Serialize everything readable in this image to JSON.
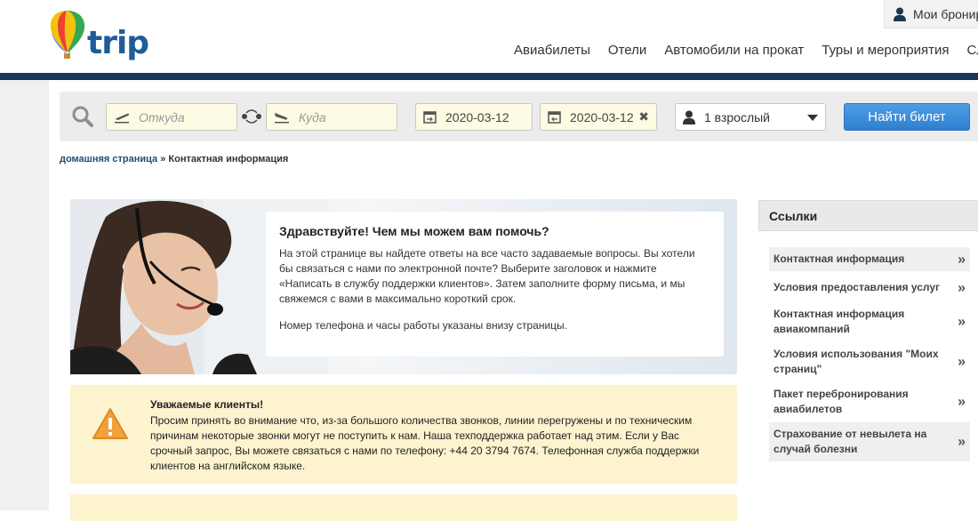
{
  "header": {
    "logo_text": "trip",
    "my_bookings": "Мои бронир",
    "nav": [
      "Авиабилеты",
      "Отели",
      "Автомобили на прокат",
      "Туры и мероприятия",
      "Сл"
    ]
  },
  "search": {
    "from_placeholder": "Откуда",
    "to_placeholder": "Куда",
    "date_depart": "2020-03-12",
    "date_return": "2020-03-12",
    "clear_symbol": "✖",
    "passengers": "1 взрослый",
    "submit": "Найти билет"
  },
  "breadcrumb": {
    "home": "домашняя страница",
    "separator": "»",
    "current": "Контактная информация"
  },
  "hero": {
    "title": "Здравствуйте! Чем мы можем вам помочь?",
    "paragraph1": "На этой странице вы найдете ответы на все часто задаваемые вопросы. Вы хотели бы связаться с нами по электронной почте? Выберите заголовок и нажмите «Написать в службу поддержки клиентов». Затем заполните форму письма, и мы свяжемся с вами в максимально короткий срок.",
    "paragraph2": "Номер телефона и часы работы указаны внизу страницы."
  },
  "notice": {
    "title": "Уважаемые клиенты!",
    "body": "Просим принять во внимание что, из-за большого количества звонков, линии перегружены и по техническим причинам некоторые звонки могут не поступить к нам. Наша техподдержка работает над этим. Если у Вас срочный запрос, Вы можете связаться с нами по телефону: +44 20 3794 7674. Телефонная служба поддержки клиентов на английском языке."
  },
  "links": {
    "title": "Ссылки",
    "arrow": "»",
    "items": [
      "Контактная информация",
      "Условия предоставления услуг",
      "Контактная информация авиакомпаний",
      "Условия использования \"Моих страниц\"",
      "Пакет перебронирования авиабилетов",
      "Страхование от невылета на случай болезни"
    ]
  },
  "colors": {
    "brand_blue": "#1f5c99",
    "nav_strip": "#1a3556",
    "button_blue": "#3a8bd9",
    "notice_bg": "#fdf3cf",
    "warning_orange": "#f0a23a"
  }
}
